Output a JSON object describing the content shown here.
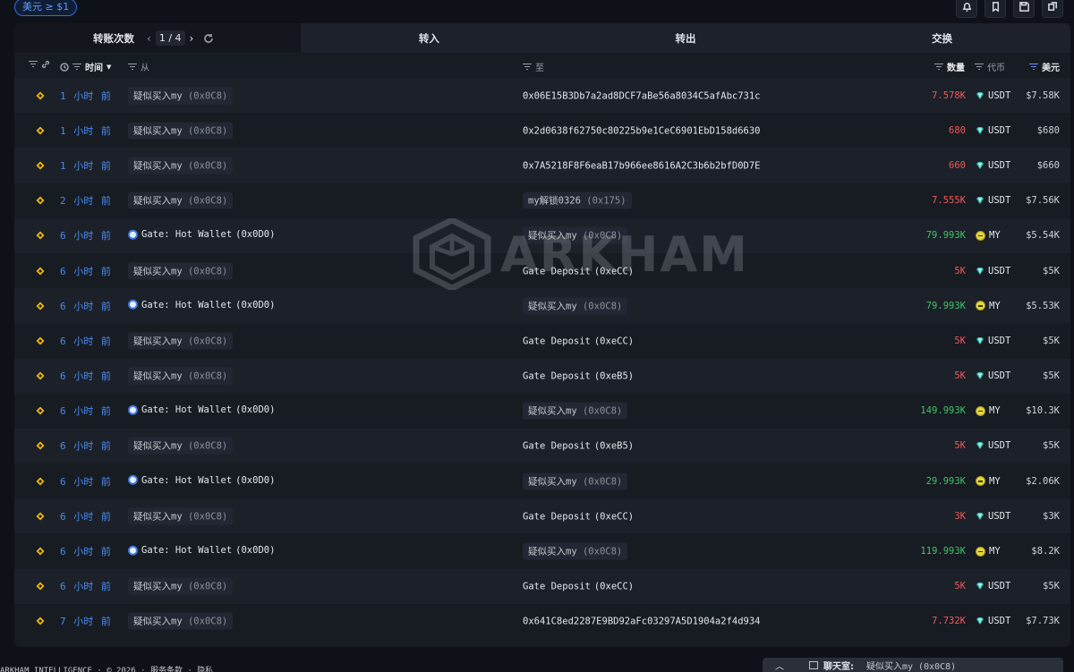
{
  "filter_chip": "美元 ≥ $1",
  "tabs": {
    "transfers_label": "转账次数",
    "page_current": "1",
    "page_sep": "/",
    "page_total": "4",
    "in_label": "转入",
    "out_label": "转出",
    "swap_label": "交换"
  },
  "columns": {
    "time": "时间",
    "from": "从",
    "to": "至",
    "amount": "数量",
    "token": "代币",
    "usd": "美元"
  },
  "rows": [
    {
      "time": "1 小时 前",
      "from": {
        "label": "疑似买入my",
        "addr": "(0x0C8)",
        "kind": "pill"
      },
      "to": {
        "label": "0x06E15B3Db7a2ad8DCF7aBe56a8034C5afAbc731c",
        "addr": "",
        "kind": "plain"
      },
      "amount": "7.578K",
      "dir": "out",
      "token": "USDT",
      "usd": "$7.58K"
    },
    {
      "time": "1 小时 前",
      "from": {
        "label": "疑似买入my",
        "addr": "(0x0C8)",
        "kind": "pill"
      },
      "to": {
        "label": "0x2d0638f62750c80225b9e1CeC6901EbD158d6630",
        "addr": "",
        "kind": "plain"
      },
      "amount": "680",
      "dir": "out",
      "token": "USDT",
      "usd": "$680"
    },
    {
      "time": "1 小时 前",
      "from": {
        "label": "疑似买入my",
        "addr": "(0x0C8)",
        "kind": "pill"
      },
      "to": {
        "label": "0x7A5218F8F6eaB17b966ee8616A2C3b6b2bfD0D7E",
        "addr": "",
        "kind": "plain"
      },
      "amount": "660",
      "dir": "out",
      "token": "USDT",
      "usd": "$660"
    },
    {
      "time": "2 小时 前",
      "from": {
        "label": "疑似买入my",
        "addr": "(0x0C8)",
        "kind": "pill"
      },
      "to": {
        "label": "my解锁0326",
        "addr": "(0x175)",
        "kind": "pill"
      },
      "amount": "7.555K",
      "dir": "out",
      "token": "USDT",
      "usd": "$7.56K"
    },
    {
      "time": "6 小时 前",
      "from": {
        "label": "Gate: Hot Wallet",
        "addr": "(0x0D0)",
        "kind": "gate"
      },
      "to": {
        "label": "疑似买入my",
        "addr": "(0x0C8)",
        "kind": "pill"
      },
      "amount": "79.993K",
      "dir": "in",
      "token": "MY",
      "usd": "$5.54K"
    },
    {
      "time": "6 小时 前",
      "from": {
        "label": "疑似买入my",
        "addr": "(0x0C8)",
        "kind": "pill"
      },
      "to": {
        "label": "Gate Deposit",
        "addr": "(0xeCC)",
        "kind": "plain"
      },
      "amount": "5K",
      "dir": "out",
      "token": "USDT",
      "usd": "$5K"
    },
    {
      "time": "6 小时 前",
      "from": {
        "label": "Gate: Hot Wallet",
        "addr": "(0x0D0)",
        "kind": "gate"
      },
      "to": {
        "label": "疑似买入my",
        "addr": "(0x0C8)",
        "kind": "pill"
      },
      "amount": "79.993K",
      "dir": "in",
      "token": "MY",
      "usd": "$5.53K"
    },
    {
      "time": "6 小时 前",
      "from": {
        "label": "疑似买入my",
        "addr": "(0x0C8)",
        "kind": "pill"
      },
      "to": {
        "label": "Gate Deposit",
        "addr": "(0xeCC)",
        "kind": "plain"
      },
      "amount": "5K",
      "dir": "out",
      "token": "USDT",
      "usd": "$5K"
    },
    {
      "time": "6 小时 前",
      "from": {
        "label": "疑似买入my",
        "addr": "(0x0C8)",
        "kind": "pill"
      },
      "to": {
        "label": "Gate Deposit",
        "addr": "(0xeB5)",
        "kind": "plain"
      },
      "amount": "5K",
      "dir": "out",
      "token": "USDT",
      "usd": "$5K"
    },
    {
      "time": "6 小时 前",
      "from": {
        "label": "Gate: Hot Wallet",
        "addr": "(0x0D0)",
        "kind": "gate"
      },
      "to": {
        "label": "疑似买入my",
        "addr": "(0x0C8)",
        "kind": "pill"
      },
      "amount": "149.993K",
      "dir": "in",
      "token": "MY",
      "usd": "$10.3K"
    },
    {
      "time": "6 小时 前",
      "from": {
        "label": "疑似买入my",
        "addr": "(0x0C8)",
        "kind": "pill"
      },
      "to": {
        "label": "Gate Deposit",
        "addr": "(0xeB5)",
        "kind": "plain"
      },
      "amount": "5K",
      "dir": "out",
      "token": "USDT",
      "usd": "$5K"
    },
    {
      "time": "6 小时 前",
      "from": {
        "label": "Gate: Hot Wallet",
        "addr": "(0x0D0)",
        "kind": "gate"
      },
      "to": {
        "label": "疑似买入my",
        "addr": "(0x0C8)",
        "kind": "pill"
      },
      "amount": "29.993K",
      "dir": "in",
      "token": "MY",
      "usd": "$2.06K"
    },
    {
      "time": "6 小时 前",
      "from": {
        "label": "疑似买入my",
        "addr": "(0x0C8)",
        "kind": "pill"
      },
      "to": {
        "label": "Gate Deposit",
        "addr": "(0xeCC)",
        "kind": "plain"
      },
      "amount": "3K",
      "dir": "out",
      "token": "USDT",
      "usd": "$3K"
    },
    {
      "time": "6 小时 前",
      "from": {
        "label": "Gate: Hot Wallet",
        "addr": "(0x0D0)",
        "kind": "gate"
      },
      "to": {
        "label": "疑似买入my",
        "addr": "(0x0C8)",
        "kind": "pill"
      },
      "amount": "119.993K",
      "dir": "in",
      "token": "MY",
      "usd": "$8.2K"
    },
    {
      "time": "6 小时 前",
      "from": {
        "label": "疑似买入my",
        "addr": "(0x0C8)",
        "kind": "pill"
      },
      "to": {
        "label": "Gate Deposit",
        "addr": "(0xeCC)",
        "kind": "plain"
      },
      "amount": "5K",
      "dir": "out",
      "token": "USDT",
      "usd": "$5K"
    },
    {
      "time": "7 小时 前",
      "from": {
        "label": "疑似买入my",
        "addr": "(0x0C8)",
        "kind": "pill"
      },
      "to": {
        "label": "0x641C8ed2287E9BD92aFc03297A5D1904a2f4d934",
        "addr": "",
        "kind": "plain"
      },
      "amount": "7.732K",
      "dir": "out",
      "token": "USDT",
      "usd": "$7.73K"
    }
  ],
  "watermark": "ARKHAM",
  "footer": "ARKHAM INTELLIGENCE · © 2026 · 服务条款 · 隐私",
  "chat": {
    "label": "聊天室:",
    "name": "疑似买入my (0x0C8)"
  },
  "colors": {
    "out": "#f05a5a",
    "in": "#3fc468",
    "time": "#4a8df0",
    "accent": "#2f6fd6"
  },
  "icons": {
    "row": "bnb-chain-icon",
    "usdt": "usdt-icon",
    "my": "my-token-icon",
    "gate": "gate-icon"
  }
}
